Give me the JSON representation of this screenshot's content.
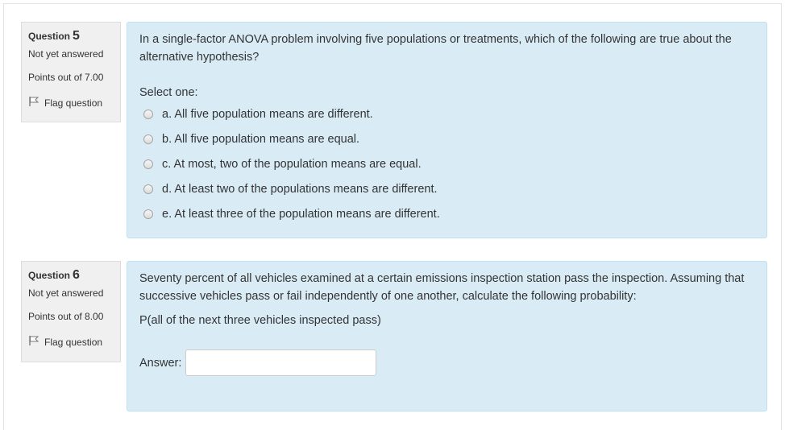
{
  "questions": [
    {
      "label": "Question",
      "number": "5",
      "state": "Not yet answered",
      "grade": "Points out of 7.00",
      "flag_label": "Flag question",
      "text": "In a single-factor ANOVA problem involving five populations or treatments, which of the following are true about the alternative hypothesis?",
      "prompt": "Select one:",
      "options": [
        "a. All five population means are different.",
        "b. All five population means are equal.",
        "c. At most, two of the population means are equal.",
        "d. At least two of the populations means are different.",
        "e. At least three of the population means are different."
      ]
    },
    {
      "label": "Question",
      "number": "6",
      "state": "Not yet answered",
      "grade": "Points out of 8.00",
      "flag_label": "Flag question",
      "text": "Seventy percent of all vehicles examined at a certain emissions inspection station pass the inspection. Assuming that successive vehicles pass or fail independently of one another, calculate the following probability:",
      "subtext": "P(all of the next three vehicles inspected pass)",
      "answer_label": "Answer:",
      "answer_value": ""
    }
  ],
  "colors": {
    "info_bg": "#f0f0f0",
    "content_bg": "#d9ecf6",
    "content_border": "#bfe0f0"
  },
  "icons": {
    "flag": "flag-icon",
    "radio": "radio-button"
  }
}
